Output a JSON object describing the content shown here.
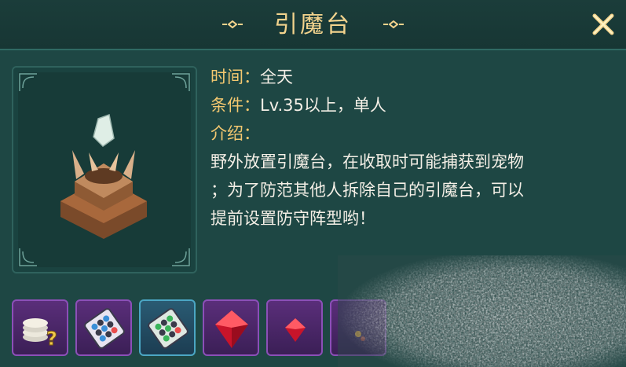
{
  "window": {
    "title": "引魔台",
    "close_icon": "close-icon"
  },
  "info": {
    "time_label": "时间：",
    "time_value": "全天",
    "condition_label": "条件：",
    "condition_value": "Lv.35以上，单人",
    "intro_label": "介绍：",
    "intro_lines": [
      "野外放置引魔台，在收取时可能捕获到宠物",
      "；为了防范其他人拆除自己的引魔台，可以",
      "提前设置防守阵型哟！"
    ]
  },
  "rewards": [
    {
      "icon": "silver-coins-question-icon",
      "rarity": "purple"
    },
    {
      "icon": "formation-card-icon",
      "rarity": "purple"
    },
    {
      "icon": "formation-card-green-icon",
      "rarity": "blue"
    },
    {
      "icon": "red-gem-large-icon",
      "rarity": "purple"
    },
    {
      "icon": "red-gem-small-icon",
      "rarity": "purple"
    },
    {
      "icon": "partial-item-icon",
      "rarity": "purple"
    }
  ],
  "colors": {
    "panel_bg": "#1e4744",
    "title_color": "#f2d38d",
    "label_color": "#f4c870",
    "text_color": "#f4efe6",
    "purple_slot": "#8c4fb8",
    "blue_slot": "#4ba6c4"
  }
}
